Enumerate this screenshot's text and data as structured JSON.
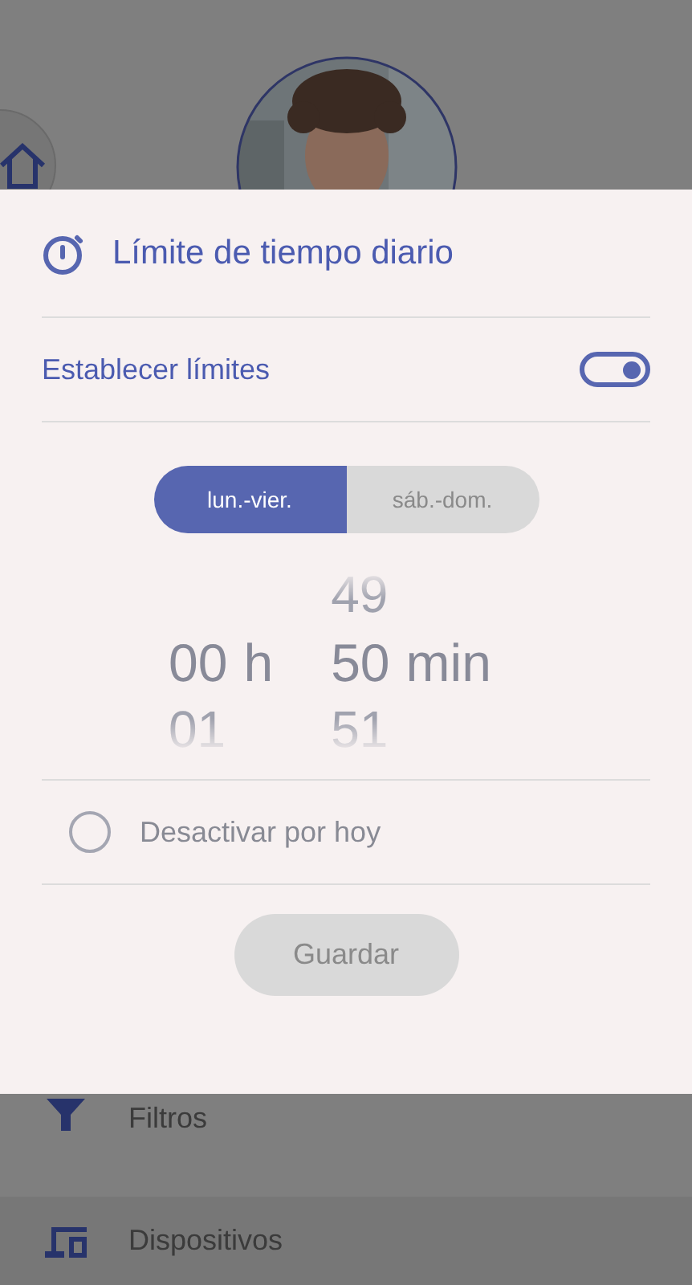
{
  "background": {
    "menu_items": [
      {
        "kind": "filter",
        "label": "Filtros",
        "selected": false
      },
      {
        "kind": "devices",
        "label": "Dispositivos",
        "selected": true
      }
    ]
  },
  "dialog": {
    "title": "Límite de tiempo diario",
    "limits_toggle": {
      "label": "Establecer límites",
      "on": true
    },
    "day_tabs": [
      {
        "label": "lun.-vier.",
        "selected": true
      },
      {
        "label": "sáb.-dom.",
        "selected": false
      }
    ],
    "picker": [
      {
        "value": "00",
        "unit": "h",
        "next": "01"
      },
      {
        "previous": "49",
        "value": "50",
        "unit": "min",
        "next": "51"
      }
    ],
    "disable_today": {
      "label": "Desactivar por hoy",
      "checked": false
    },
    "save_button": {
      "label": "Guardar",
      "disabled": true
    }
  }
}
